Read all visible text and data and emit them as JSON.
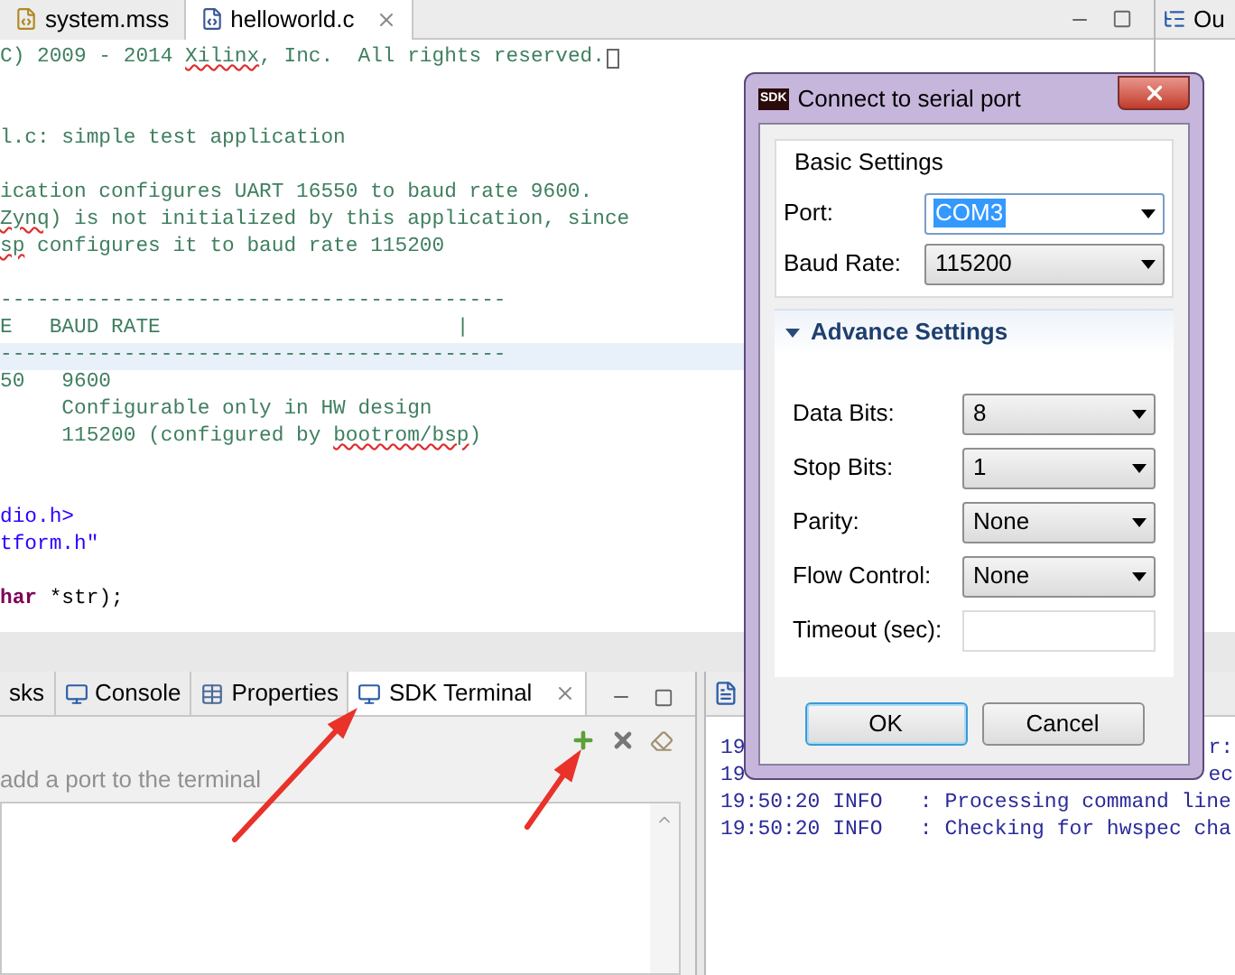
{
  "editor": {
    "tabs": [
      {
        "label": "system.mss",
        "selected": false
      },
      {
        "label": "helloworld.c",
        "selected": true
      }
    ],
    "lines": [
      {
        "current": false,
        "parts": [
          {
            "text": "C) 2009 - 2014 ",
            "kind": "comment"
          },
          {
            "text": "Xilinx",
            "kind": "flagged"
          },
          {
            "text": ", Inc.  All rights reserved.",
            "kind": "comment"
          }
        ],
        "cursor": true
      },
      {
        "current": false
      },
      {
        "current": false
      },
      {
        "current": false,
        "parts": [
          {
            "text": "l.c: simple test application",
            "kind": "comment"
          }
        ]
      },
      {
        "current": false
      },
      {
        "current": false,
        "parts": [
          {
            "text": "ication configures UART 16550 to baud rate 9600.",
            "kind": "comment"
          }
        ]
      },
      {
        "current": false,
        "parts": [
          {
            "text": "Zynq",
            "kind": "flagged"
          },
          {
            "text": ") is not initialized by this application, since",
            "kind": "comment"
          }
        ]
      },
      {
        "current": false,
        "parts": [
          {
            "text": "sp",
            "kind": "flagged"
          },
          {
            "text": " configures it to baud rate 115200",
            "kind": "comment"
          }
        ]
      },
      {
        "current": false
      },
      {
        "current": false,
        "parts": [
          {
            "text": "-----------------------------------------",
            "kind": "comment"
          }
        ]
      },
      {
        "current": false,
        "parts": [
          {
            "text": "E   BAUD RATE                        |",
            "kind": "comment"
          }
        ]
      },
      {
        "current": true,
        "parts": [
          {
            "text": "-----------------------------------------",
            "kind": "comment"
          }
        ]
      },
      {
        "current": false,
        "parts": [
          {
            "text": "50   9600",
            "kind": "comment"
          }
        ]
      },
      {
        "current": false,
        "parts": [
          {
            "text": "     Configurable only in HW design",
            "kind": "comment"
          }
        ]
      },
      {
        "current": false,
        "parts": [
          {
            "text": "     115200 (configured by ",
            "kind": "comment"
          },
          {
            "text": "bootrom/bsp",
            "kind": "flagged"
          },
          {
            "text": ")",
            "kind": "comment"
          }
        ]
      },
      {
        "current": false
      },
      {
        "current": false
      },
      {
        "current": false,
        "parts": [
          {
            "text": "dio.h>",
            "kind": "string"
          }
        ]
      },
      {
        "current": false,
        "parts": [
          {
            "text": "tform.h\"",
            "kind": "string"
          }
        ]
      },
      {
        "current": false
      },
      {
        "current": false,
        "parts": [
          {
            "text": "har",
            "kind": "keyword"
          },
          {
            "text": " *str);",
            "kind": "plain"
          }
        ]
      }
    ]
  },
  "outline": {
    "tab_label": "Ou"
  },
  "terminal_pane": {
    "tabs": [
      {
        "label": "sks",
        "selected": false
      },
      {
        "label": "Console",
        "selected": false
      },
      {
        "label": "Properties",
        "selected": false
      },
      {
        "label": "SDK Terminal",
        "selected": true
      }
    ],
    "hint": "add a port to the terminal"
  },
  "log_pane": {
    "lines": [
      {
        "text": "19",
        "tail": "r:"
      },
      {
        "text": "19",
        "tail": "ec"
      },
      {
        "text": "19:50:20 INFO   : Processing command line"
      },
      {
        "text": "19:50:20 INFO   : Checking for hwspec cha"
      }
    ]
  },
  "dialog": {
    "title": "Connect to serial port",
    "app_badge": "SDK",
    "basic": {
      "title": "Basic Settings",
      "fields": [
        {
          "label": "Port:",
          "value": "COM3",
          "kind": "editable",
          "highlighted": true
        },
        {
          "label": "Baud Rate:",
          "value": "115200",
          "kind": "dropdown",
          "highlighted": false
        }
      ]
    },
    "advance": {
      "title": "Advance Settings",
      "expanded": true,
      "fields": [
        {
          "label": "Data Bits:",
          "value": "8",
          "kind": "dropdown"
        },
        {
          "label": "Stop Bits:",
          "value": "1",
          "kind": "dropdown"
        },
        {
          "label": "Parity:",
          "value": "None",
          "kind": "dropdown"
        },
        {
          "label": "Flow Control:",
          "value": "None",
          "kind": "dropdown"
        },
        {
          "label": "Timeout (sec):",
          "kind": "text"
        }
      ]
    },
    "buttons": [
      {
        "label": "OK",
        "default": true
      },
      {
        "label": "Cancel",
        "default": false
      }
    ]
  }
}
